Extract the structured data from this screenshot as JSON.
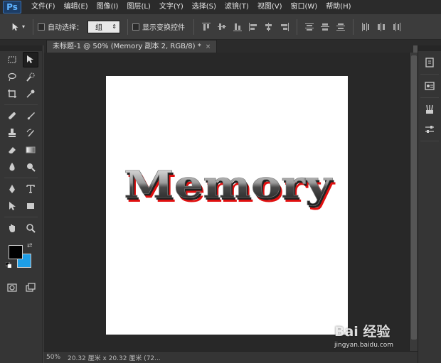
{
  "app": {
    "logo": "Ps"
  },
  "menu": {
    "items": [
      "文件(F)",
      "编辑(E)",
      "图像(I)",
      "图层(L)",
      "文字(Y)",
      "选择(S)",
      "滤镜(T)",
      "视图(V)",
      "窗口(W)",
      "帮助(H)"
    ]
  },
  "options": {
    "auto_select_label": "自动选择：",
    "auto_select_value": "组",
    "show_transform_label": "显示变换控件"
  },
  "document": {
    "tab_title": "未标题-1 @ 50% (Memory 副本 2, RGB/8) *",
    "close_glyph": "×",
    "canvas_text": "Memory"
  },
  "colors": {
    "foreground": "#000000",
    "background": "#1e9ee6",
    "text_shadow": "#e01010"
  },
  "status": {
    "zoom": "50%",
    "doc_size": "20.32 厘米 x 20.32 厘米 (72..."
  },
  "watermark": {
    "brand": "Bai 经验",
    "url": "jingyan.baidu.com"
  }
}
